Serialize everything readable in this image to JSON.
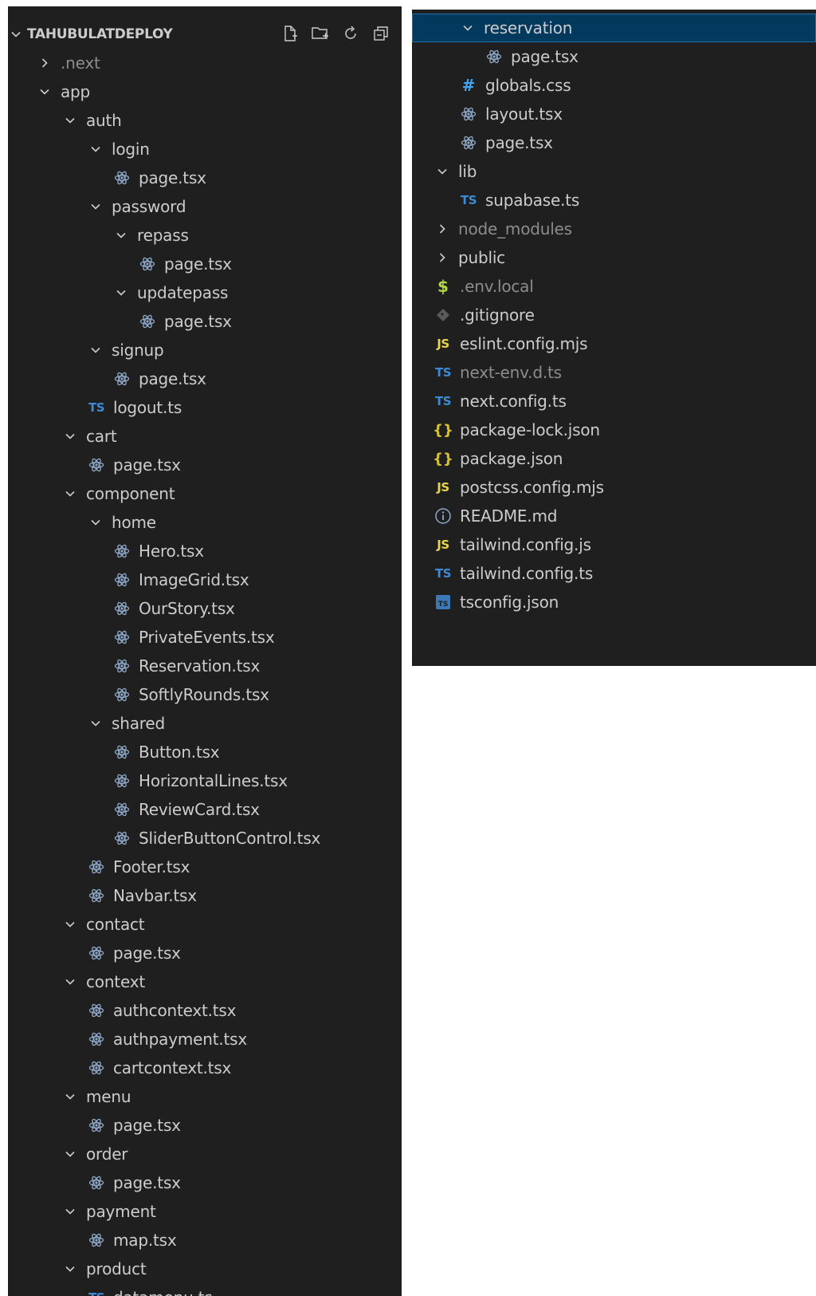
{
  "explorer": {
    "title": "TAHUBULATDEPLOY",
    "actions": [
      "new-file-icon",
      "new-folder-icon",
      "refresh-icon",
      "collapse-all-icon"
    ]
  },
  "left_tree": [
    {
      "label": ".next",
      "type": "folder",
      "open": false,
      "dim": true
    },
    {
      "label": "app",
      "type": "folder",
      "open": true
    },
    {
      "label": "auth",
      "type": "folder",
      "open": true
    },
    {
      "label": "login",
      "type": "folder",
      "open": true
    },
    {
      "label": "page.tsx",
      "type": "react"
    },
    {
      "label": "password",
      "type": "folder",
      "open": true
    },
    {
      "label": "repass",
      "type": "folder",
      "open": true
    },
    {
      "label": "page.tsx",
      "type": "react"
    },
    {
      "label": "updatepass",
      "type": "folder",
      "open": true
    },
    {
      "label": "page.tsx",
      "type": "react"
    },
    {
      "label": "signup",
      "type": "folder",
      "open": true
    },
    {
      "label": "page.tsx",
      "type": "react"
    },
    {
      "label": "logout.ts",
      "type": "ts"
    },
    {
      "label": "cart",
      "type": "folder",
      "open": true
    },
    {
      "label": "page.tsx",
      "type": "react"
    },
    {
      "label": "component",
      "type": "folder",
      "open": true
    },
    {
      "label": "home",
      "type": "folder",
      "open": true
    },
    {
      "label": "Hero.tsx",
      "type": "react"
    },
    {
      "label": "ImageGrid.tsx",
      "type": "react"
    },
    {
      "label": "OurStory.tsx",
      "type": "react"
    },
    {
      "label": "PrivateEvents.tsx",
      "type": "react"
    },
    {
      "label": "Reservation.tsx",
      "type": "react"
    },
    {
      "label": "SoftlyRounds.tsx",
      "type": "react"
    },
    {
      "label": "shared",
      "type": "folder",
      "open": true
    },
    {
      "label": "Button.tsx",
      "type": "react"
    },
    {
      "label": "HorizontalLines.tsx",
      "type": "react"
    },
    {
      "label": "ReviewCard.tsx",
      "type": "react"
    },
    {
      "label": "SliderButtonControl.tsx",
      "type": "react"
    },
    {
      "label": "Footer.tsx",
      "type": "react"
    },
    {
      "label": "Navbar.tsx",
      "type": "react"
    },
    {
      "label": "contact",
      "type": "folder",
      "open": true
    },
    {
      "label": "page.tsx",
      "type": "react"
    },
    {
      "label": "context",
      "type": "folder",
      "open": true
    },
    {
      "label": "authcontext.tsx",
      "type": "react"
    },
    {
      "label": "authpayment.tsx",
      "type": "react"
    },
    {
      "label": "cartcontext.tsx",
      "type": "react"
    },
    {
      "label": "menu",
      "type": "folder",
      "open": true
    },
    {
      "label": "page.tsx",
      "type": "react"
    },
    {
      "label": "order",
      "type": "folder",
      "open": true
    },
    {
      "label": "page.tsx",
      "type": "react"
    },
    {
      "label": "payment",
      "type": "folder",
      "open": true
    },
    {
      "label": "map.tsx",
      "type": "react"
    },
    {
      "label": "product",
      "type": "folder",
      "open": true
    },
    {
      "label": "datamenu.ts",
      "type": "ts"
    }
  ],
  "right_tree": [
    {
      "label": "reservation",
      "type": "folder",
      "open": true,
      "selected": true
    },
    {
      "label": "page.tsx",
      "type": "react"
    },
    {
      "label": "globals.css",
      "type": "css"
    },
    {
      "label": "layout.tsx",
      "type": "react"
    },
    {
      "label": "page.tsx",
      "type": "react"
    },
    {
      "label": "lib",
      "type": "folder",
      "open": true
    },
    {
      "label": "supabase.ts",
      "type": "ts"
    },
    {
      "label": "node_modules",
      "type": "folder",
      "open": false,
      "dim": true
    },
    {
      "label": "public",
      "type": "folder",
      "open": false
    },
    {
      "label": ".env.local",
      "type": "env",
      "dim": true
    },
    {
      "label": ".gitignore",
      "type": "git"
    },
    {
      "label": "eslint.config.mjs",
      "type": "js"
    },
    {
      "label": "next-env.d.ts",
      "type": "ts",
      "dim": true
    },
    {
      "label": "next.config.ts",
      "type": "ts"
    },
    {
      "label": "package-lock.json",
      "type": "json"
    },
    {
      "label": "package.json",
      "type": "json"
    },
    {
      "label": "postcss.config.mjs",
      "type": "js"
    },
    {
      "label": "README.md",
      "type": "info"
    },
    {
      "label": "tailwind.config.js",
      "type": "js"
    },
    {
      "label": "tailwind.config.ts",
      "type": "ts"
    },
    {
      "label": "tsconfig.json",
      "type": "tsconfig"
    }
  ],
  "colors": {
    "background": "#1f1f1f",
    "text": "#cccccc",
    "dim_text": "#8c8c8c",
    "selection": "#04395e",
    "react_icon": "#8fa9c9",
    "ts_icon": "#3d8bd6",
    "js_icon": "#e8d44d",
    "json_icon": "#d6c232",
    "env_icon": "#b4d641"
  }
}
